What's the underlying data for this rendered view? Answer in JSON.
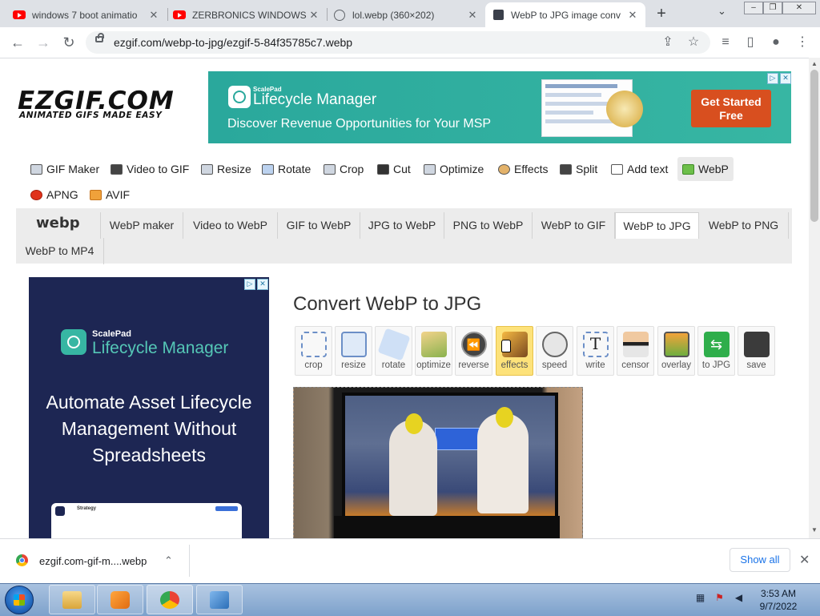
{
  "browser": {
    "tabs": [
      {
        "title": "windows 7 boot animatio",
        "icon": "youtube-icon",
        "active": false
      },
      {
        "title": "ZERBRONICS WINDOWS",
        "icon": "youtube-icon",
        "active": false
      },
      {
        "title": "lol.webp (360×202)",
        "icon": "globe-icon",
        "active": false
      },
      {
        "title": "WebP to JPG image conv",
        "icon": "ezgif-icon",
        "active": true
      }
    ],
    "url": "ezgif.com/webp-to-jpg/ezgif-5-84f35785c7.webp"
  },
  "logo": {
    "title": "EZGIF.COM",
    "tagline": "ANIMATED GIFS MADE EASY"
  },
  "ad_top": {
    "brand_small": "ScalePad",
    "brand": "Lifecycle Manager",
    "tagline": "Discover Revenue Opportunities for Your MSP",
    "cta": "Get Started Free"
  },
  "main_nav": [
    {
      "label": "GIF Maker",
      "icon": "gif-maker-icon"
    },
    {
      "label": "Video to GIF",
      "icon": "film-icon"
    },
    {
      "label": "Resize",
      "icon": "resize-icon"
    },
    {
      "label": "Rotate",
      "icon": "rotate-icon"
    },
    {
      "label": "Crop",
      "icon": "crop-icon"
    },
    {
      "label": "Cut",
      "icon": "cut-icon"
    },
    {
      "label": "Optimize",
      "icon": "optimize-icon"
    },
    {
      "label": "Effects",
      "icon": "palette-icon"
    },
    {
      "label": "Split",
      "icon": "split-icon"
    },
    {
      "label": "Add text",
      "icon": "text-icon"
    },
    {
      "label": "WebP",
      "icon": "webp-icon"
    },
    {
      "label": "APNG",
      "icon": "apng-icon"
    },
    {
      "label": "AVIF",
      "icon": "avif-icon"
    }
  ],
  "sub_nav": {
    "logo": "webp",
    "items": [
      "WebP maker",
      "Video to WebP",
      "GIF to WebP",
      "JPG to WebP",
      "PNG to WebP",
      "WebP to GIF",
      "WebP to JPG",
      "WebP to PNG",
      "WebP to MP4"
    ],
    "selected": "WebP to JPG"
  },
  "ad_left": {
    "brand_small": "ScalePad",
    "brand": "Lifecycle Manager",
    "headline": "Automate Asset Lifecycle Management Without Spreadsheets",
    "shot_title": "Strategy"
  },
  "main": {
    "title": "Convert WebP to JPG",
    "tools": [
      {
        "label": "crop",
        "icon": "crop-tool-icon"
      },
      {
        "label": "resize",
        "icon": "resize-tool-icon"
      },
      {
        "label": "rotate",
        "icon": "rotate-tool-icon"
      },
      {
        "label": "optimize",
        "icon": "broom-icon"
      },
      {
        "label": "reverse",
        "icon": "rewind-icon"
      },
      {
        "label": "effects",
        "icon": "magic-wand-icon"
      },
      {
        "label": "speed",
        "icon": "stopwatch-icon"
      },
      {
        "label": "write",
        "icon": "text-tool-icon"
      },
      {
        "label": "censor",
        "icon": "censor-icon"
      },
      {
        "label": "overlay",
        "icon": "overlay-icon"
      },
      {
        "label": "to JPG",
        "icon": "convert-arrows-icon"
      },
      {
        "label": "save",
        "icon": "floppy-disk-icon"
      }
    ],
    "active_tool": "effects"
  },
  "download": {
    "filename": "ezgif.com-gif-m....webp",
    "show_all": "Show all"
  },
  "taskbar": {
    "time": "3:53 AM",
    "date": "9/7/2022"
  }
}
